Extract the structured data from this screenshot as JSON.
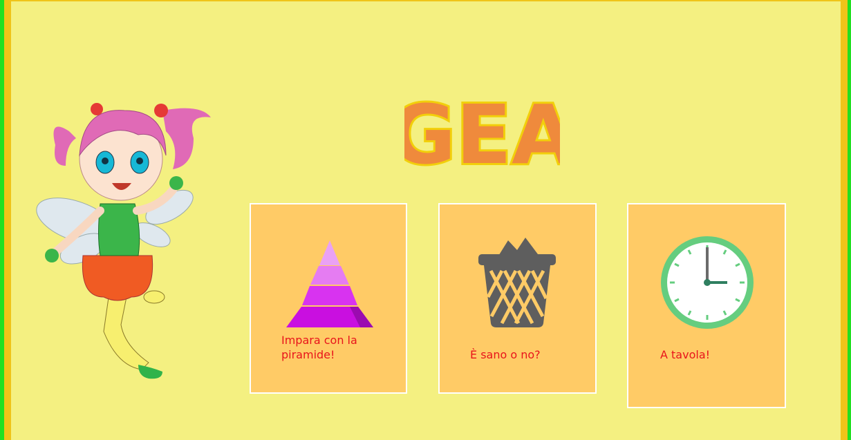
{
  "title": "GEA",
  "cards": [
    {
      "label": "Impara con la piramide!",
      "icon": "pyramid-icon"
    },
    {
      "label": "È sano o no?",
      "icon": "trash-bin-icon"
    },
    {
      "label": "A tavola!",
      "icon": "clock-icon"
    }
  ],
  "colors": {
    "outer_border": "#21e021",
    "frame": "#efc419",
    "background": "#f4f081",
    "card": "#ffcb66",
    "card_border": "#ffffff",
    "label": "#e8141b"
  }
}
